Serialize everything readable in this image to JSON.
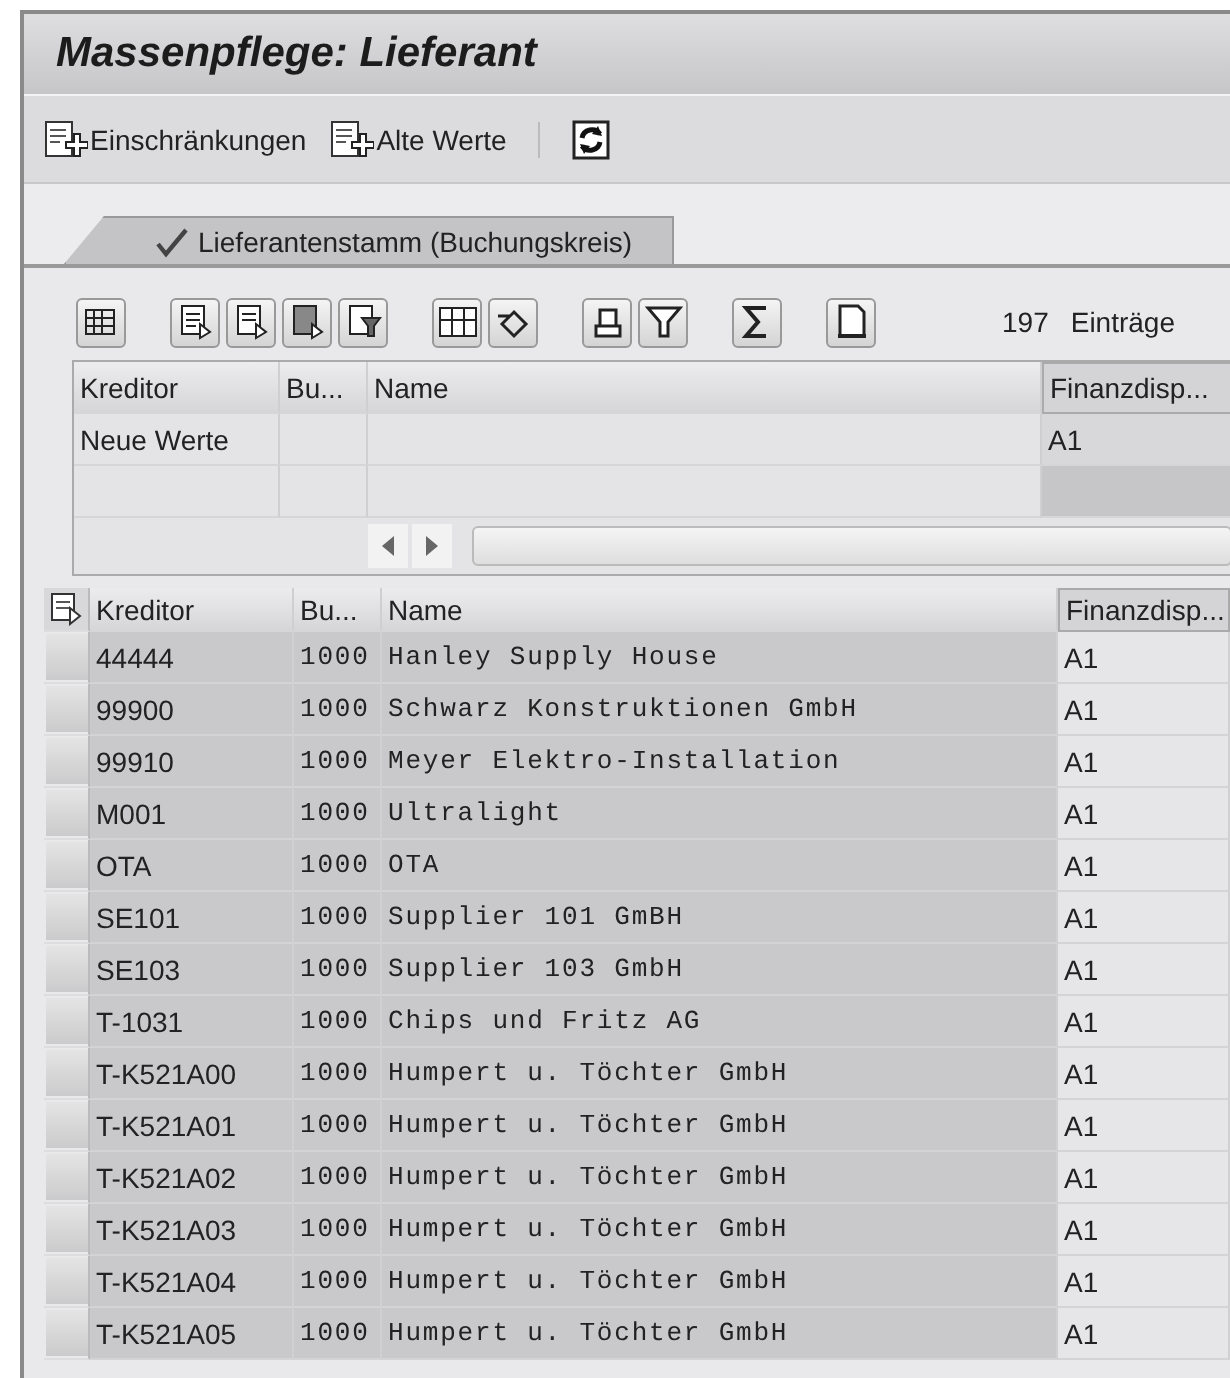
{
  "window": {
    "title": "Massenpflege: Lieferant"
  },
  "toolbar": [
    {
      "kind": "restrict",
      "label": "Einschränkungen"
    },
    {
      "kind": "old",
      "label": "Alte Werte"
    },
    {
      "kind": "refresh"
    }
  ],
  "tabs": [
    {
      "label": "Lieferantenstamm (Buchungskreis)",
      "selected": true
    }
  ],
  "grid_toolbar": {
    "count": "197",
    "count_label": "Einträge"
  },
  "new_values": {
    "columns": [
      "Kreditor",
      "Bu...",
      "Name",
      "Finanzdisp..."
    ],
    "rows": [
      [
        "Neue Werte",
        "",
        "",
        "A1"
      ]
    ]
  },
  "table": {
    "columns": [
      "Kreditor",
      "Bu...",
      "Name",
      "Finanzdisp..."
    ],
    "rows": [
      [
        "44444",
        "1000",
        "Hanley Supply House",
        "A1"
      ],
      [
        "99900",
        "1000",
        "Schwarz Konstruktionen GmbH",
        "A1"
      ],
      [
        "99910",
        "1000",
        "Meyer Elektro-Installation",
        "A1"
      ],
      [
        "M001",
        "1000",
        "Ultralight",
        "A1"
      ],
      [
        "OTA",
        "1000",
        "OTA",
        "A1"
      ],
      [
        "SE101",
        "1000",
        "Supplier 101 GmBH",
        "A1"
      ],
      [
        "SE103",
        "1000",
        "Supplier 103 GmbH",
        "A1"
      ],
      [
        "T-1031",
        "1000",
        "Chips und Fritz AG",
        "A1"
      ],
      [
        "T-K521A00",
        "1000",
        "Humpert u. Töchter GmbH",
        "A1"
      ],
      [
        "T-K521A01",
        "1000",
        "Humpert u. Töchter GmbH",
        "A1"
      ],
      [
        "T-K521A02",
        "1000",
        "Humpert u. Töchter GmbH",
        "A1"
      ],
      [
        "T-K521A03",
        "1000",
        "Humpert u. Töchter GmbH",
        "A1"
      ],
      [
        "T-K521A04",
        "1000",
        "Humpert u. Töchter GmbH",
        "A1"
      ],
      [
        "T-K521A05",
        "1000",
        "Humpert u. Töchter GmbH",
        "A1"
      ]
    ]
  }
}
